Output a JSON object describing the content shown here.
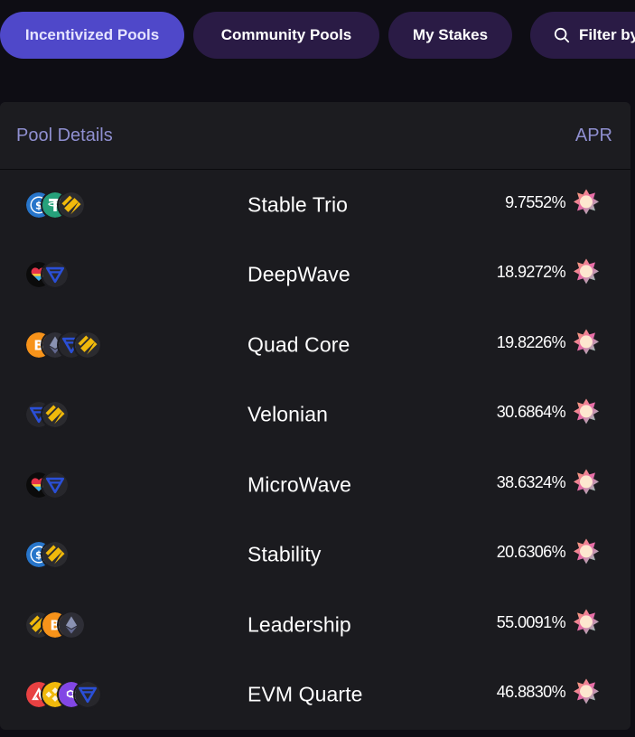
{
  "tabs": [
    {
      "label": "Incentivized Pools",
      "active": true
    },
    {
      "label": "Community Pools",
      "active": false
    },
    {
      "label": "My Stakes",
      "active": false
    },
    {
      "label": "Filter by",
      "icon": "search-icon"
    }
  ],
  "table": {
    "header_pool": "Pool Details",
    "header_apr": "APR",
    "rows": [
      {
        "name": "Stable Trio",
        "apr": "9.7552%",
        "icons": [
          "usdc-icon",
          "tether-icon",
          "bnb-icon"
        ]
      },
      {
        "name": "DeepWave",
        "apr": "18.9272%",
        "icons": [
          "heart-icon",
          "blue-v-icon"
        ]
      },
      {
        "name": "Quad Core",
        "apr": "19.8226%",
        "icons": [
          "bitcoin-icon",
          "ethereum-icon",
          "blue-v-icon",
          "bnb-icon"
        ]
      },
      {
        "name": "Velonian",
        "apr": "30.6864%",
        "icons": [
          "blue-v-icon",
          "bnb-icon"
        ]
      },
      {
        "name": "MicroWave",
        "apr": "38.6324%",
        "icons": [
          "heart-icon",
          "blue-v-icon"
        ]
      },
      {
        "name": "Stability",
        "apr": "20.6306%",
        "icons": [
          "usdc-icon",
          "bnb-icon"
        ]
      },
      {
        "name": "Leadership",
        "apr": "55.0091%",
        "icons": [
          "bnb-icon",
          "bitcoin-icon",
          "ethereum-icon"
        ]
      },
      {
        "name": "EVM Quarte",
        "apr": "46.8830%",
        "icons": [
          "avalanche-icon",
          "bnb-gold-icon",
          "polygon-icon",
          "blue-v-icon"
        ]
      }
    ]
  },
  "colors": {
    "active_tab": "#4f48c9",
    "inactive_tab": "#2a1b45",
    "header_text": "#8f8fd0",
    "card_bg": "#1b1b1f"
  }
}
